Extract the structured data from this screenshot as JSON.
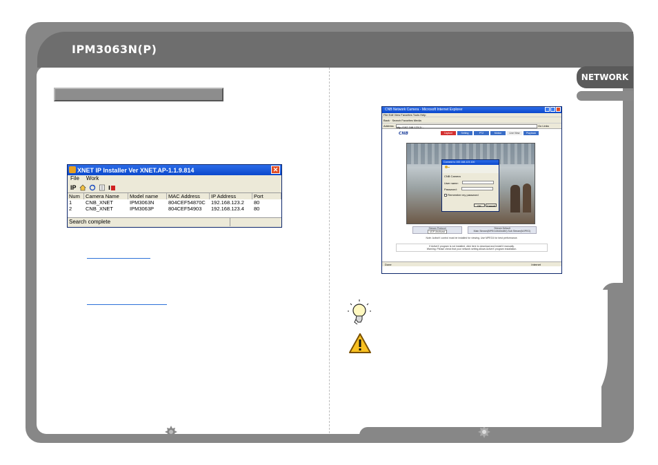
{
  "header": {
    "title": "IPM3063N(P)",
    "tab": "NETWORK"
  },
  "xnet": {
    "title": "XNET IP Installer Ver XNET.AP-1.1.9.814",
    "close_glyph": "✕",
    "menu": [
      "File",
      "Work"
    ],
    "tool_ip": "IP",
    "columns": [
      "Num",
      "Camera Name",
      "Model name",
      "MAC Address",
      "IP Address",
      "Port"
    ],
    "rows": [
      [
        "1",
        "CNB_XNET",
        "IPM3063N",
        "804CEF54870C",
        "192.168.123.2",
        "80"
      ],
      [
        "2",
        "CNB_XNET",
        "IPM3063P",
        "804CEF54903",
        "192.168.123.4",
        "80"
      ]
    ],
    "status": "Search complete"
  },
  "ie": {
    "title": "CNB Network Camera - Microsoft Internet Explorer",
    "menu": "File  Edit  View  Favorites  Tools  Help",
    "toolbar": "Back  ·  Search  Favorites  Media",
    "address_label": "Address",
    "address": "http://192.168.123.2/...",
    "go_label": "Go",
    "links_label": "Links",
    "logo": "CNB",
    "nav": [
      "Capture",
      "Setting",
      "PTZ",
      "Motion",
      "Live View",
      "Playback"
    ],
    "dialog_title": "Connect to 192.168.123.100",
    "dialog_site": "CNB Camera",
    "dialog_user_label": "User name:",
    "dialog_pass_label": "Password:",
    "dialog_remember": "Remember my password",
    "dialog_ok": "OK",
    "dialog_cancel": "Cancel",
    "stream_label": "Stream Protocol",
    "stream_select": "UDP-Multicast",
    "stream_default": "Stream Default",
    "stream_default_value": "Main Stream(MPEG4/640x480)  Sub Stream(MJPEG)",
    "note1": "Note: ActiveX control must be installed for viewing. Use MPEG4 for best performance.",
    "note2": "If ActiveX program is not installed, click here to download and install it manually.",
    "note3": "Warning: Please check that your network setting allows ActiveX program installation.",
    "status_left": "Done",
    "status_right": "Internet"
  }
}
